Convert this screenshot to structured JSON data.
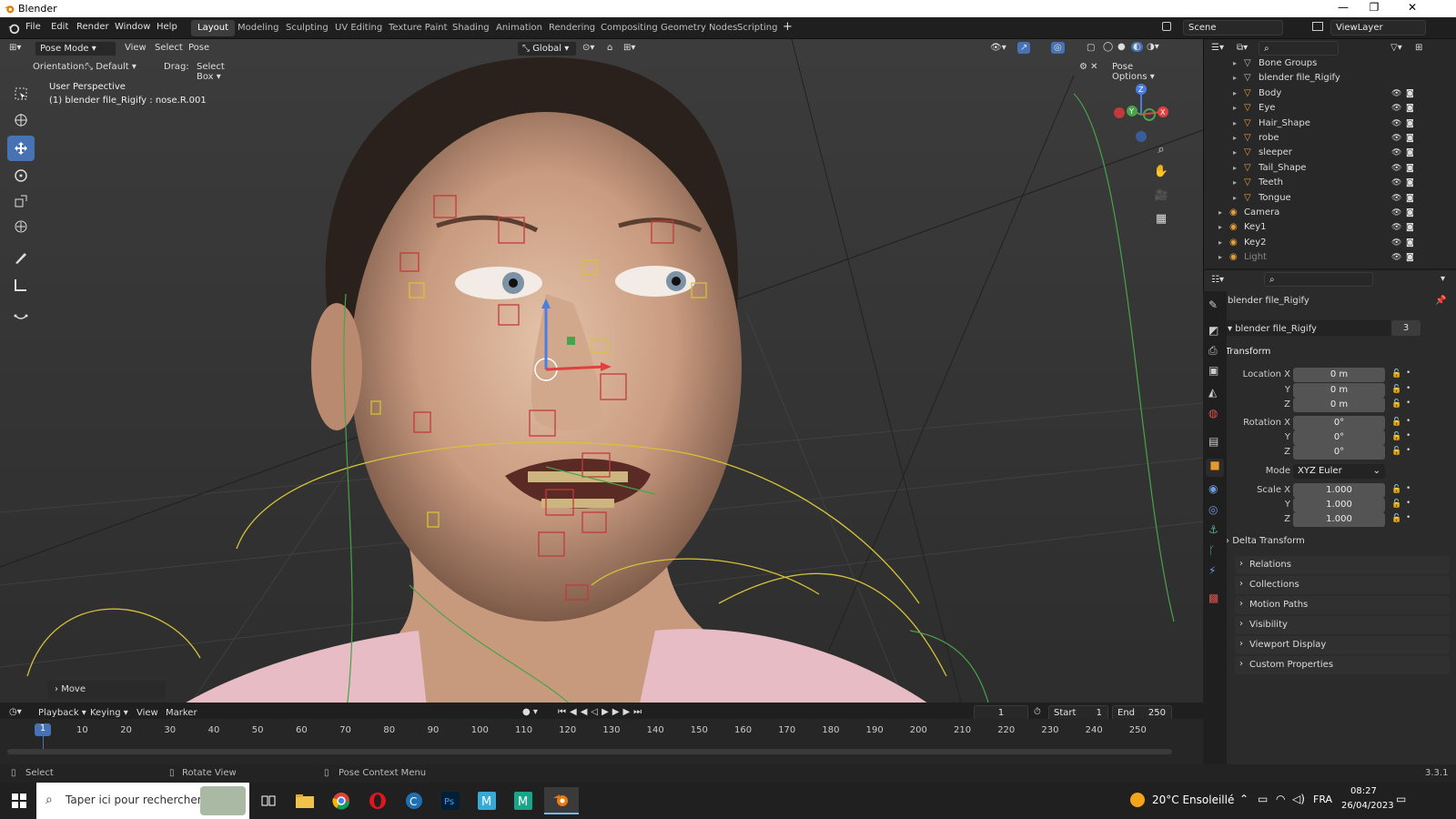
{
  "window": {
    "title": "Blender",
    "minimize": "—",
    "maximize": "❐",
    "close": "✕"
  },
  "menu": [
    "File",
    "Edit",
    "Render",
    "Window",
    "Help"
  ],
  "workspaces": [
    "Layout",
    "Modeling",
    "Sculpting",
    "UV Editing",
    "Texture Paint",
    "Shading",
    "Animation",
    "Rendering",
    "Compositing",
    "Geometry Nodes",
    "Scripting"
  ],
  "active_workspace": "Layout",
  "scene": {
    "label": "Scene",
    "viewlayer": "ViewLayer"
  },
  "viewport_header": {
    "mode": "Pose Mode",
    "menus": [
      "View",
      "Select",
      "Pose"
    ],
    "transform_orientation": "Global",
    "orientation_label": "Orientation:",
    "orientation_value": "Default",
    "drag_label": "Drag:",
    "drag_value": "Select Box",
    "pose_options": "Pose Options"
  },
  "viewport_overlay": {
    "line1": "User Perspective",
    "line2": "(1) blender file_Rigify : nose.R.001",
    "last_op": "Move"
  },
  "gizmo": {
    "x": "X",
    "y": "Y",
    "z": "Z"
  },
  "outliner": {
    "items": [
      {
        "name": "Bone Groups",
        "indent": 2,
        "vis": false
      },
      {
        "name": "blender file_Rigify",
        "indent": 2,
        "vis": false
      },
      {
        "name": "Body",
        "indent": 2,
        "vis": true
      },
      {
        "name": "Eye",
        "indent": 2,
        "vis": true
      },
      {
        "name": "Hair_Shape",
        "indent": 2,
        "vis": true
      },
      {
        "name": "robe",
        "indent": 2,
        "vis": true
      },
      {
        "name": "sleeper",
        "indent": 2,
        "vis": true
      },
      {
        "name": "Tail_Shape",
        "indent": 2,
        "vis": true
      },
      {
        "name": "Teeth",
        "indent": 2,
        "vis": true
      },
      {
        "name": "Tongue",
        "indent": 2,
        "vis": true
      },
      {
        "name": "Camera",
        "indent": 1,
        "vis": true
      },
      {
        "name": "Key1",
        "indent": 1,
        "vis": true
      },
      {
        "name": "Key2",
        "indent": 1,
        "vis": true
      },
      {
        "name": "Light",
        "indent": 1,
        "vis": true
      }
    ]
  },
  "properties": {
    "object_name": "blender file_Rigify",
    "data_name": "blender file_Rigify",
    "users": "3",
    "transform_header": "Transform",
    "location": {
      "label": "Location X",
      "x": "0 m",
      "y": "0 m",
      "z": "0 m"
    },
    "rotation": {
      "label": "Rotation X",
      "x": "0°",
      "y": "0°",
      "z": "0°"
    },
    "axis_y": "Y",
    "axis_z": "Z",
    "mode_label": "Mode",
    "mode_value": "XYZ Euler",
    "scale": {
      "label": "Scale X",
      "x": "1.000",
      "y": "1.000",
      "z": "1.000"
    },
    "delta": "Delta Transform",
    "sections": [
      "Relations",
      "Collections",
      "Motion Paths",
      "Visibility",
      "Viewport Display",
      "Custom Properties"
    ]
  },
  "timeline": {
    "menus": [
      "Playback",
      "Keying",
      "View",
      "Marker"
    ],
    "current_frame": "1",
    "start_label": "Start",
    "start": "1",
    "end_label": "End",
    "end": "250",
    "ticks": [
      "10",
      "20",
      "30",
      "40",
      "50",
      "60",
      "70",
      "80",
      "90",
      "100",
      "110",
      "120",
      "130",
      "140",
      "150",
      "160",
      "170",
      "180",
      "190",
      "200",
      "210",
      "220",
      "230",
      "240",
      "250"
    ],
    "playhead": "1"
  },
  "statusbar": {
    "select": "Select",
    "rotate": "Rotate View",
    "context": "Pose Context Menu",
    "version": "3.3.1"
  },
  "taskbar": {
    "search": "Taper ici pour rechercher",
    "weather": "20°C  Ensoleillé",
    "lang": "FRA",
    "time": "08:27",
    "date": "26/04/2023"
  },
  "colors": {
    "accent": "#4772b3",
    "viewport": "#393939",
    "panel": "#2b2b2b",
    "bone_red": "#c23a3a",
    "bone_yellow": "#d6c23a",
    "bone_green": "#49a34a"
  }
}
